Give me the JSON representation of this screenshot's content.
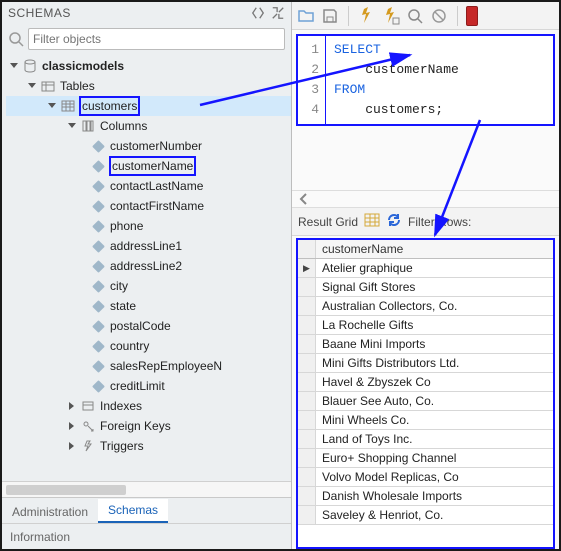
{
  "left": {
    "title": "SCHEMAS",
    "filter_placeholder": "Filter objects",
    "db_name": "classicmodels",
    "tables_label": "Tables",
    "table_name": "customers",
    "columns_label": "Columns",
    "columns": [
      "customerNumber",
      "customerName",
      "contactLastName",
      "contactFirstName",
      "phone",
      "addressLine1",
      "addressLine2",
      "city",
      "state",
      "postalCode",
      "country",
      "salesRepEmployeeN",
      "creditLimit"
    ],
    "groups_after": [
      "Indexes",
      "Foreign Keys",
      "Triggers"
    ],
    "tabs": {
      "admin": "Administration",
      "schemas": "Schemas"
    },
    "info_label": "Information"
  },
  "sql": {
    "lines": [
      "1",
      "2",
      "3",
      "4"
    ],
    "kw_select": "SELECT",
    "col": "    customerName",
    "kw_from": "FROM",
    "tbl": "    customers;"
  },
  "results": {
    "tablabel": "Result Grid",
    "filter_label": "Filter Rows:",
    "header": "customerName",
    "rows": [
      "Atelier graphique",
      "Signal Gift Stores",
      "Australian Collectors, Co.",
      "La Rochelle Gifts",
      "Baane Mini Imports",
      "Mini Gifts Distributors Ltd.",
      "Havel & Zbyszek Co",
      "Blauer See Auto, Co.",
      "Mini Wheels Co.",
      "Land of Toys Inc.",
      "Euro+ Shopping Channel",
      "Volvo Model Replicas, Co",
      "Danish Wholesale Imports",
      "Saveley & Henriot, Co."
    ]
  }
}
